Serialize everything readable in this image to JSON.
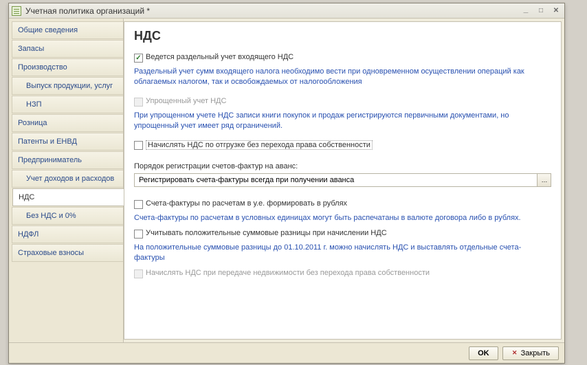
{
  "window": {
    "title": "Учетная политика организаций *"
  },
  "sidebar": {
    "items": [
      {
        "label": "Общие сведения"
      },
      {
        "label": "Запасы"
      },
      {
        "label": "Производство"
      },
      {
        "label": "Выпуск продукции, услуг"
      },
      {
        "label": "НЗП"
      },
      {
        "label": "Розница"
      },
      {
        "label": "Патенты и ЕНВД"
      },
      {
        "label": "Предприниматель"
      },
      {
        "label": "Учет доходов и расходов"
      },
      {
        "label": "НДС"
      },
      {
        "label": "Без НДС и 0%"
      },
      {
        "label": "НДФЛ"
      },
      {
        "label": "Страховые взносы"
      }
    ]
  },
  "main": {
    "title": "НДС",
    "separate_accounting": {
      "label": "Ведется раздельный учет входящего НДС",
      "hint": "Раздельный учет сумм входящего налога необходимо вести при одновременном осуществлении операций как облагаемых налогом, так и освобождаемых от налогообложения"
    },
    "simplified": {
      "label": "Упрощенный учет НДС",
      "hint": "При упрощенном учете НДС записи книги покупок и продаж регистрируются первичными документами, но упрощенный учет имеет ряд ограничений."
    },
    "shipment_no_transfer": {
      "label": "Начислять НДС по отгрузке без перехода права собственности"
    },
    "advance_order": {
      "label": "Порядок регистрации счетов-фактур на аванс:",
      "value": "Регистрировать счета-фактуры всегда при получении аванса"
    },
    "invoices_ye": {
      "label": "Счета-фактуры по расчетам в у.е. формировать в рублях",
      "hint": "Счета-фактуры по расчетам в условных единицах могут быть распечатаны в валюте договора либо в рублях."
    },
    "positive_diff": {
      "label": "Учитывать положительные суммовые разницы при начислении НДС",
      "hint": "На положительные суммовые разницы до 01.10.2011 г. можно начислять НДС и выставлять отдельные счета-фактуры"
    },
    "real_estate": {
      "label": "Начислять НДС при передаче недвижимости без перехода права собственности"
    }
  },
  "footer": {
    "ok": "OK",
    "close": "Закрыть"
  }
}
